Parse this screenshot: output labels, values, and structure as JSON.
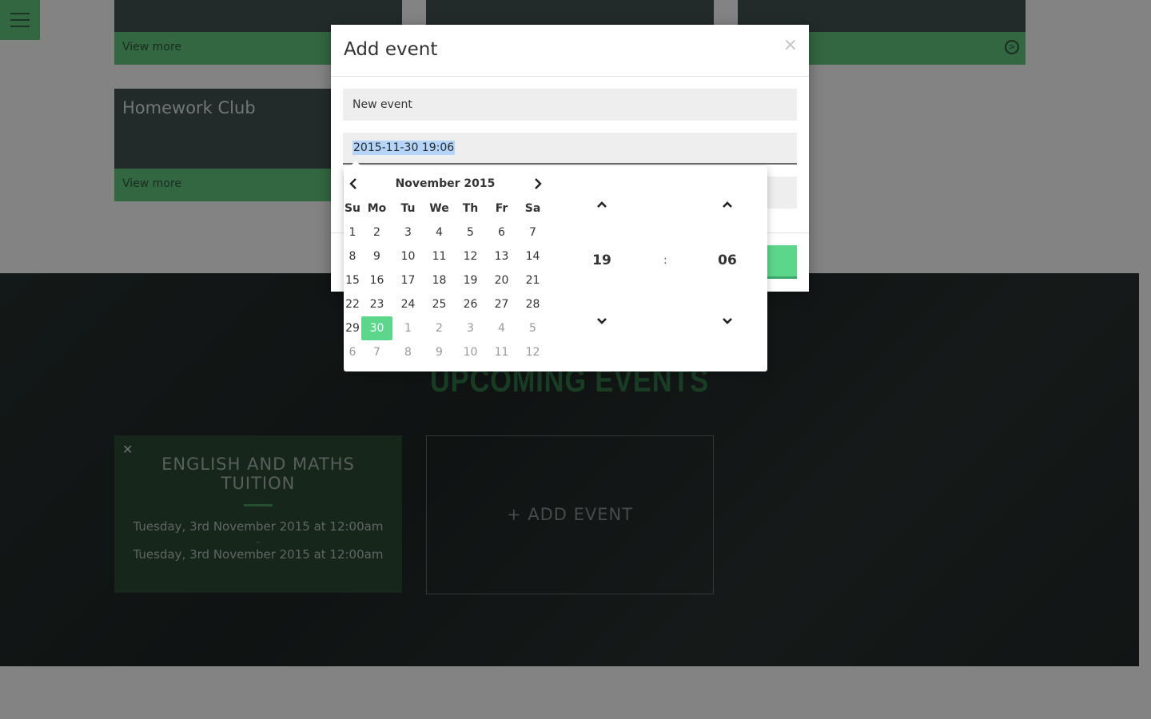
{
  "background": {
    "cards": [
      {
        "title": "",
        "footer_link": "View more"
      },
      {
        "title": "",
        "footer_link": ""
      },
      {
        "title": "",
        "footer_link": ""
      },
      {
        "title": "Homework Club",
        "footer_link": "View more"
      }
    ],
    "events_section": {
      "title": "UPCOMING EVENTS",
      "event": {
        "close": "✕",
        "title": "ENGLISH AND MATHS TUITION",
        "start": "Tuesday, 3rd November 2015 at 12:00am",
        "end": "Tuesday, 3rd November 2015 at 12:00am"
      },
      "add_event_label": "+ ADD EVENT"
    }
  },
  "modal": {
    "title": "Add event",
    "close": "×",
    "name_value": "New event",
    "date_value": "2015-11-30 19:06"
  },
  "picker": {
    "month_label": "November 2015",
    "weekdays": [
      "Su",
      "Mo",
      "Tu",
      "We",
      "Th",
      "Fr",
      "Sa"
    ],
    "weeks": [
      [
        {
          "d": "1"
        },
        {
          "d": "2"
        },
        {
          "d": "3"
        },
        {
          "d": "4"
        },
        {
          "d": "5"
        },
        {
          "d": "6"
        },
        {
          "d": "7"
        }
      ],
      [
        {
          "d": "8"
        },
        {
          "d": "9"
        },
        {
          "d": "10"
        },
        {
          "d": "11"
        },
        {
          "d": "12"
        },
        {
          "d": "13"
        },
        {
          "d": "14"
        }
      ],
      [
        {
          "d": "15"
        },
        {
          "d": "16"
        },
        {
          "d": "17"
        },
        {
          "d": "18"
        },
        {
          "d": "19"
        },
        {
          "d": "20"
        },
        {
          "d": "21"
        }
      ],
      [
        {
          "d": "22"
        },
        {
          "d": "23"
        },
        {
          "d": "24"
        },
        {
          "d": "25"
        },
        {
          "d": "26"
        },
        {
          "d": "27"
        },
        {
          "d": "28"
        }
      ],
      [
        {
          "d": "29"
        },
        {
          "d": "30",
          "active": true
        },
        {
          "d": "1",
          "other": true
        },
        {
          "d": "2",
          "other": true
        },
        {
          "d": "3",
          "other": true
        },
        {
          "d": "4",
          "other": true
        },
        {
          "d": "5",
          "other": true
        }
      ],
      [
        {
          "d": "6",
          "other": true
        },
        {
          "d": "7",
          "other": true
        },
        {
          "d": "8",
          "other": true
        },
        {
          "d": "9",
          "other": true
        },
        {
          "d": "10",
          "other": true
        },
        {
          "d": "11",
          "other": true
        },
        {
          "d": "12",
          "other": true
        }
      ]
    ],
    "hour": "19",
    "separator": ":",
    "minute": "06"
  },
  "colors": {
    "accent": "#5cd68a",
    "green_footer": "#58b573",
    "card_dark": "#3d4b4a"
  },
  "icons": [
    "hamburger-icon",
    "chevron-left-icon",
    "chevron-right-icon",
    "chevron-up-icon",
    "chevron-down-icon",
    "circle-arrow-icon",
    "close-icon"
  ]
}
